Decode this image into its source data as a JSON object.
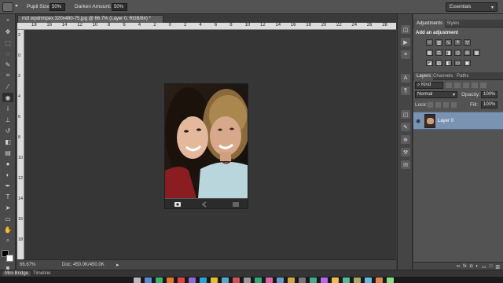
{
  "options_bar": {
    "pupil_size_label": "Pupil Size:",
    "pupil_size_value": "50%",
    "darken_amount_label": "Darken Amount:",
    "darken_amount_value": "50%",
    "workspace": "Essentials"
  },
  "document": {
    "tab_title": "mzl.wpdnmpex.320x480-75.jpg @ 66.7% (Layer 0, RGB/8#) *",
    "ruler_top_ticks": [
      "18",
      "16",
      "14",
      "12",
      "10",
      "8",
      "6",
      "4",
      "2",
      "0",
      "2",
      "4",
      "6",
      "8",
      "10",
      "12",
      "14",
      "16",
      "18",
      "20",
      "22",
      "24",
      "26",
      "28"
    ],
    "ruler_left_ticks": [
      "2",
      "0",
      "2",
      "4",
      "6",
      "8",
      "10",
      "12",
      "14",
      "16",
      "18"
    ],
    "zoom": "66.67%",
    "doc_size": "Doc: 450.0K/450.0K"
  },
  "panels": {
    "top_tabs": [
      "Adjustments",
      "Styles"
    ],
    "add_adjustment": "Add an adjustment",
    "layer_tabs": [
      "Layers",
      "Channels",
      "Paths"
    ],
    "kind_filter": "Kind",
    "blend_mode": "Normal",
    "opacity_label": "Opacity:",
    "opacity_value": "100%",
    "lock_label": "Lock:",
    "fill_label": "Fill:",
    "fill_value": "100%",
    "layer_name": "Layer 0"
  },
  "bottom_tabs": [
    "Mini Bridge",
    "Timeline"
  ],
  "colors": {
    "ui_dark": "#535353",
    "canvas_bg": "#363636",
    "layer_selected": "#7b93b3"
  }
}
